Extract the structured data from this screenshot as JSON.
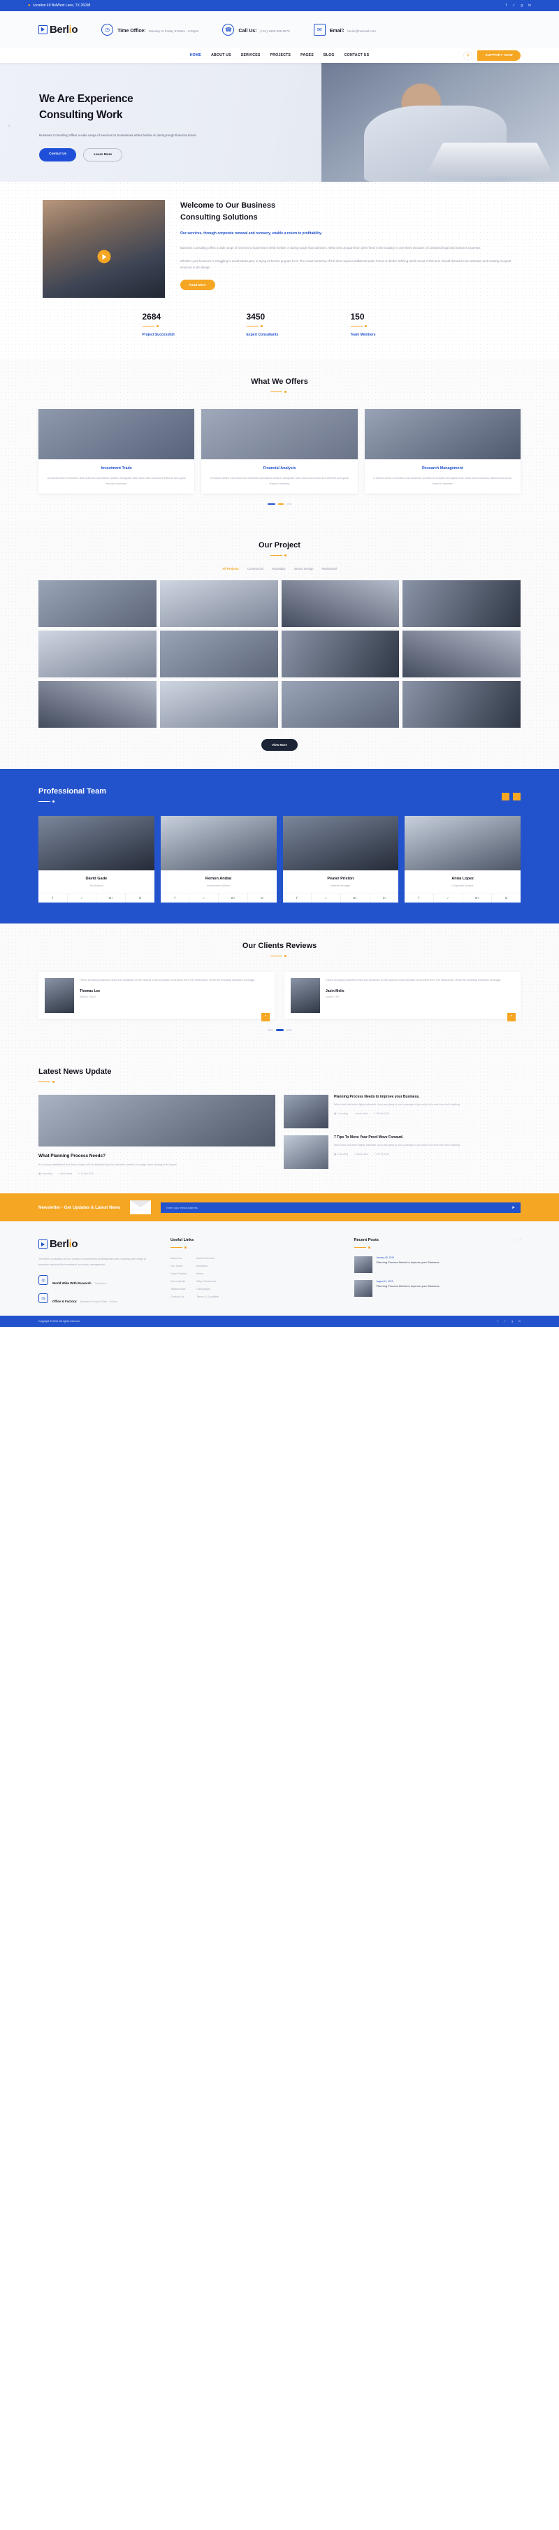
{
  "topbar": {
    "location": "Location 49 BelWest Lane, TX 26098",
    "social": [
      "f",
      "✓",
      "g",
      "in"
    ]
  },
  "brand": {
    "name_a": "Berl",
    "name_b": "i",
    "name_c": "o",
    "full": "Berlio"
  },
  "infostrip": [
    {
      "icon": "clock-icon",
      "title": "Time Office:",
      "sub": "Monday to Friday 9:00am - 6:00pm"
    },
    {
      "icon": "phone-icon",
      "title": "Call Us:",
      "sub": "(+91) 1300 555 6578"
    },
    {
      "icon": "email-icon",
      "title": "Email:",
      "sub": "berlio@hotmail.com"
    }
  ],
  "nav": {
    "items": [
      {
        "label": "HOME",
        "active": true
      },
      {
        "label": "ABOUT US",
        "active": false
      },
      {
        "label": "SERVICES",
        "active": false
      },
      {
        "label": "PROJECTS",
        "active": false
      },
      {
        "label": "PAGES",
        "active": false
      },
      {
        "label": "BLOG",
        "active": false
      },
      {
        "label": "CONTACT US",
        "active": false
      }
    ],
    "search_icon": "⚲",
    "support_button": "SUPPORT NOW"
  },
  "hero": {
    "title_line1": "We Are Experience",
    "title_line2": "Consulting Work",
    "paragraph": "Business Consulting offers a wide range of services to businesses either before or during tough financial times.",
    "btn_primary": "Contact Us",
    "btn_secondary": "Learn More"
  },
  "welcome": {
    "title_line1": "Welcome to Our Business",
    "title_line2": "Consulting Solutions",
    "lead": "Our services, through corporate renewal and recovery, enable a return to profitability.",
    "paragraph1": "Business Consulting offers a wide range of services to businesses either before or during tough financial times. What sets us apart from other firms in the industry is over three decades of combined legal and business expertise.",
    "paragraph2": "Whether your business is struggling to avoid bankruptcy or trying its best to prepare for it. The visual hierarchy of this item requires additional work. Focus on better defining which areas of this item should demand more attention and creating a logical structure to the design",
    "button": "Read More",
    "play_icon": "play-icon"
  },
  "stats": [
    {
      "number": "2684",
      "label": "Project Successfull"
    },
    {
      "number": "3450",
      "label": "Expert Consultants"
    },
    {
      "number": "150",
      "label": "Team Members"
    }
  ],
  "offers": {
    "heading": "What We Offers",
    "cards": [
      {
        "title": "Investment Trade",
        "text": "A market-driven execution and business operations solution alongside wide value-add resources efficient and quick finance overview"
      },
      {
        "title": "Financial Analysis",
        "text": "A market-driven execution and business operations solution alongside wide value-add resources efficient and quick finance overview"
      },
      {
        "title": "Research Management",
        "text": "A market-driven execution and business operations solution alongside wide value-add resources efficient and quick finance overview"
      }
    ]
  },
  "projects": {
    "heading": "Our Project",
    "filters": [
      {
        "label": "All Projects",
        "active": true
      },
      {
        "label": "Commercial",
        "active": false
      },
      {
        "label": "Hospitality",
        "active": false
      },
      {
        "label": "Interior Design",
        "active": false
      },
      {
        "label": "Residential",
        "active": false
      }
    ],
    "view_more": "View More"
  },
  "team": {
    "heading": "Professional Team",
    "members": [
      {
        "name": "David Gade",
        "role": "Tax Advisor"
      },
      {
        "name": "Remon Andial",
        "role": "Investment Advisor"
      },
      {
        "name": "Peater Priston",
        "role": "Market Manager"
      },
      {
        "name": "Anna Lopez",
        "role": "Corporate Advisor"
      }
    ],
    "social": [
      "f",
      "✓",
      "G+",
      "in"
    ]
  },
  "reviews": {
    "heading": "Our Clients Reviews",
    "items": [
      {
        "text": "Follow browsing business news and headlines on the world's most important consumers from The Newsroom. Read the browsing Business coverage.",
        "name": "Thomas Lee",
        "role": "Medion Travel"
      },
      {
        "text": "Follow browsing business news and headlines on the world's most important consumers from The Newsroom. Read the browsing Business coverage.",
        "name": "Jasin Melis",
        "role": "Leader CEO"
      }
    ]
  },
  "news": {
    "heading": "Latest News Update",
    "featured": {
      "title": "What Planning Process Needs?",
      "text": "It is a long established fact that a reader will be distracted by the readable content of a page when looking at its layout.",
      "meta": [
        "▣ Consulting",
        "○ Alexis Mark",
        "⏱ 15 Feb 2019"
      ]
    },
    "side": [
      {
        "title": "Planning Process Needs to improve your Business.",
        "text": "Which kind took even slightly tailorable. It you are going to use a passage of you need to be sure there isn't anything.",
        "meta": [
          "▣ Consulting",
          "○ Alexis Mark",
          "⏱ 15 Feb 2019"
        ]
      },
      {
        "title": "7 Tips To Move Your Proof Move Forward.",
        "text": "Which kind took even slightly tailorable. It you are going to use a passage of you need to be sure there isn't anything.",
        "meta": [
          "▣ Consulting",
          "○ Alexis Mark",
          "⏱ 15 Feb 2019"
        ]
      }
    ]
  },
  "newsletter": {
    "title": "Newsletter - Get Updates & Latest News",
    "placeholder": "Enter your email address",
    "send_icon": "➤"
  },
  "footer": {
    "about": "The Berlio consulting firm for a team of experienced professionals with a leading wide range of expertise services like investment, economy, management.",
    "contacts": [
      {
        "icon": "map-icon",
        "title": "World Wide With Research",
        "sub": "Tax Advisor"
      },
      {
        "icon": "clock-icon",
        "title": "Office & Factory:",
        "sub": "Monday to Friday 9:00am - 6:00pm"
      }
    ],
    "useful_links_title": "Useful Links",
    "useful_links_col1": [
      "About Us",
      "Our Team",
      "Case Studies",
      "Get a Quote",
      "Testimonials",
      "Contact Us"
    ],
    "useful_links_col2": [
      "Market Service",
      "Investors",
      "News",
      "Why Choose Us",
      "Campaigns",
      "Terms & Condition"
    ],
    "recent_posts_title": "Recent Posts",
    "posts": [
      {
        "date": "January 05, 2019",
        "text": "Planning Process Needs to improve your Business."
      },
      {
        "date": "August 14, 2019",
        "text": "Planning Process Needs to improve your Business."
      }
    ],
    "recent_arrows": [
      "‹",
      "›"
    ],
    "copyright": "Copyright © 2019. All rights reserved.",
    "social": [
      "f",
      "✓",
      "g",
      "in"
    ]
  },
  "colors": {
    "brand_blue": "#2353cc",
    "accent_orange": "#f5a623",
    "dark": "#12121c"
  }
}
